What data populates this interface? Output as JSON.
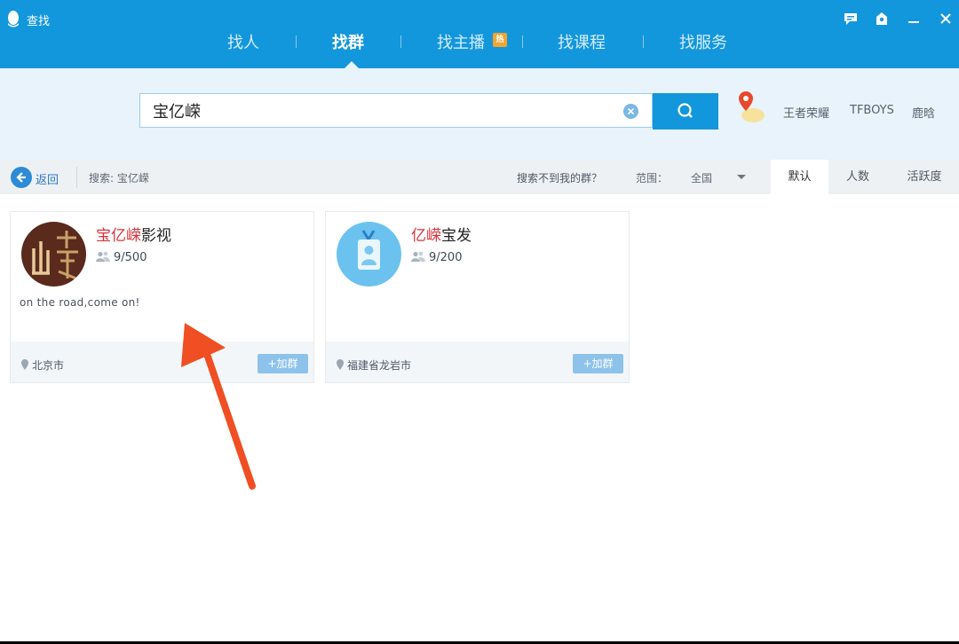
{
  "window": {
    "title": "查找",
    "controls": [
      "chat-icon",
      "skin-icon",
      "minimize-icon",
      "close-icon"
    ]
  },
  "tabs": [
    {
      "label": "找人",
      "active": false
    },
    {
      "label": "找群",
      "active": true
    },
    {
      "label": "找主播",
      "active": false,
      "badge": "热"
    },
    {
      "label": "找课程",
      "active": false
    },
    {
      "label": "找服务",
      "active": false
    }
  ],
  "search": {
    "value": "宝亿嵘",
    "placeholder": "",
    "hot_words": [
      "王者荣耀",
      "TFBOYS",
      "鹿晗"
    ]
  },
  "filter": {
    "back_label": "返回",
    "search_summary": "搜索: 宝亿嵘",
    "no_result_prompt": "搜索不到我的群？",
    "range_label": "范围：",
    "range_value": "全国",
    "sort_tabs": [
      {
        "label": "默认",
        "active": true
      },
      {
        "label": "人数",
        "active": false
      },
      {
        "label": "活跃度",
        "active": false
      }
    ]
  },
  "results": [
    {
      "name_highlight": "宝亿嵘",
      "name_rest": "影视",
      "members": "9/500",
      "description": "on the road,come on!",
      "city": "北京市",
      "join_label": "+加群"
    },
    {
      "name_highlight": "亿嵘",
      "name_rest": "宝发",
      "members": "9/200",
      "description": "",
      "city": "福建省龙岩市",
      "join_label": "+加群"
    }
  ],
  "colors": {
    "brand": "#1397dc",
    "highlight": "#d9333a",
    "annotation_arrow": "#f04e23"
  }
}
